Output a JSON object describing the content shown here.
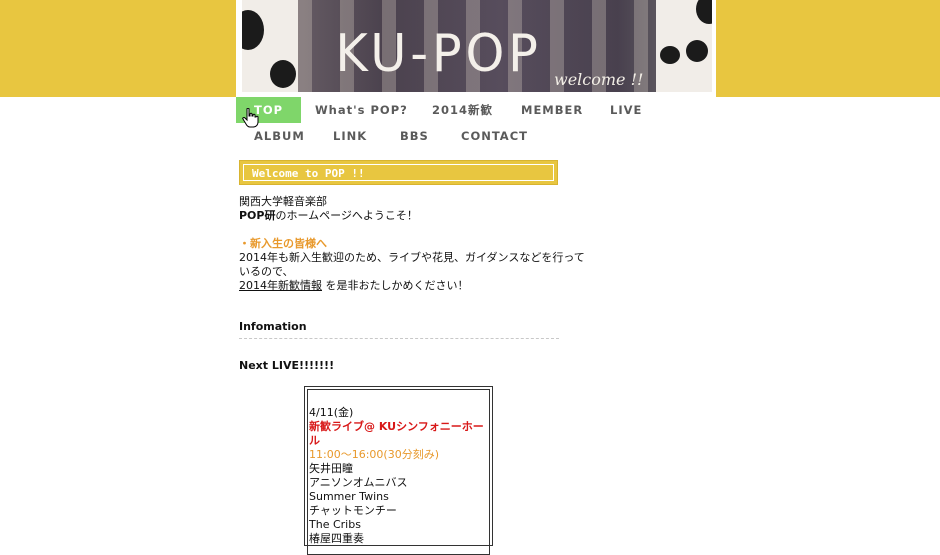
{
  "header": {
    "logo": "KU-POP",
    "welcome": "welcome !!"
  },
  "nav": {
    "items": [
      {
        "label": "TOP",
        "active": true
      },
      {
        "label": "What's POP?"
      },
      {
        "label": "2014新歓"
      },
      {
        "label": "MEMBER"
      },
      {
        "label": "LIVE"
      },
      {
        "label": "ALBUM"
      },
      {
        "label": "LINK"
      },
      {
        "label": "BBS"
      },
      {
        "label": "CONTACT"
      }
    ]
  },
  "welcome_box": {
    "title": "Welcome to POP !!"
  },
  "intro": {
    "line1": "関西大学軽音楽部",
    "line2_bold": "POP研",
    "line2_rest": "のホームページへようこそ！",
    "newcomer_heading": "・新入生の皆様へ",
    "body1": "2014年も新入生歓迎のため、ライブや花見、ガイダンスなどを行って",
    "body2": "いるので、",
    "link_text": "2014年新歓情報",
    "body3": " を是非おたしかめください！"
  },
  "info": {
    "title": "Infomation",
    "next_live": "Next LIVE!!!!!!!"
  },
  "live": {
    "date": "4/11(金)",
    "event": " 新歓ライブ@ KUシンフォニーホール",
    "time": " 11:00〜16:00(30分刻み)",
    "bands": [
      "矢井田瞳",
      "アニソンオムニバス",
      "Summer Twins",
      "チャットモンチー",
      "The Cribs",
      "椿屋四重奏"
    ]
  },
  "colors": {
    "accent_yellow": "#e8c640",
    "nav_active_green": "#7fd66a",
    "orange": "#e8992c",
    "red": "#d81818"
  }
}
